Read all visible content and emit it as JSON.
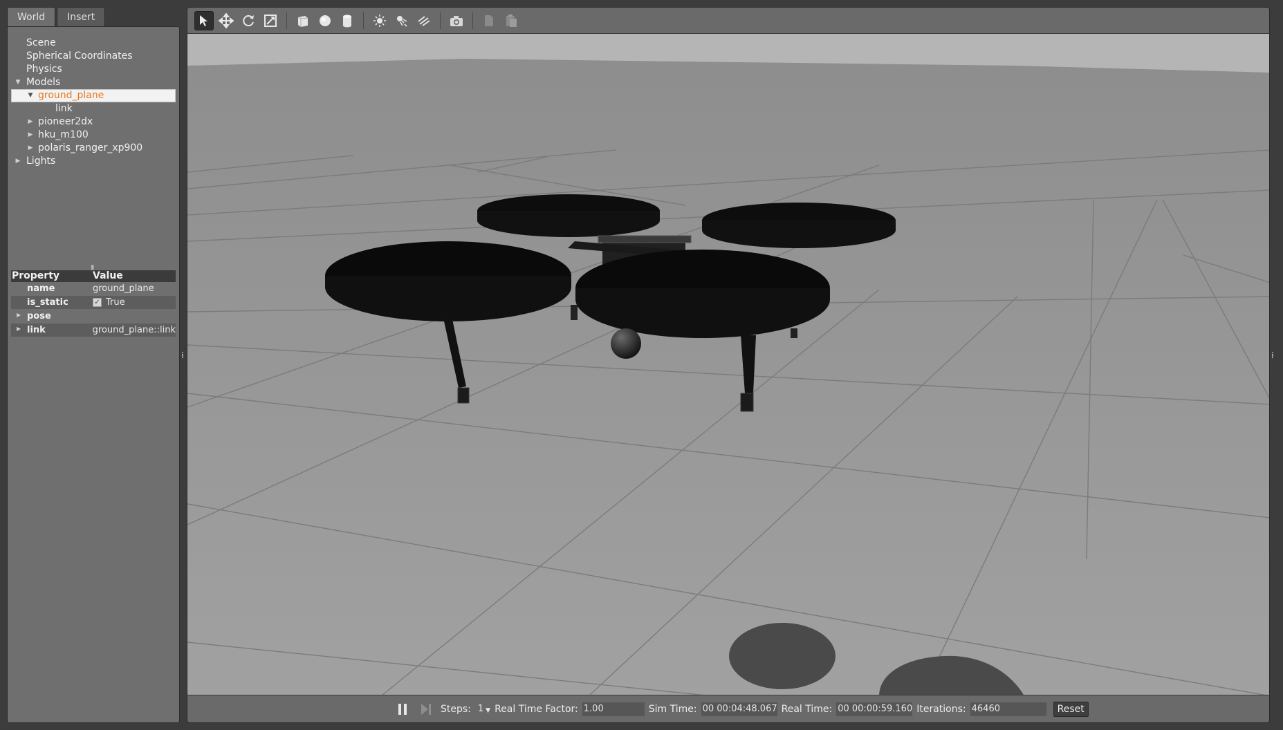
{
  "tabs": [
    {
      "label": "World",
      "active": true
    },
    {
      "label": "Insert",
      "active": false
    }
  ],
  "tree": {
    "scene": "Scene",
    "spherical": "Spherical Coordinates",
    "physics": "Physics",
    "models": "Models",
    "ground_plane": "ground_plane",
    "link": "link",
    "pioneer": "pioneer2dx",
    "hku": "hku_m100",
    "polaris": "polaris_ranger_xp900",
    "lights": "Lights"
  },
  "properties": {
    "header_property": "Property",
    "header_value": "Value",
    "rows": [
      {
        "key": "name",
        "value": "ground_plane"
      },
      {
        "key": "is_static",
        "value": "True"
      },
      {
        "key": "pose",
        "value": ""
      },
      {
        "key": "link",
        "value": "ground_plane::link"
      }
    ]
  },
  "toolbar": {
    "icons": [
      "select-arrow-icon",
      "translate-icon",
      "rotate-icon",
      "scale-icon",
      "box-icon",
      "sphere-icon",
      "cylinder-icon",
      "point-light-icon",
      "spot-light-icon",
      "directional-light-icon",
      "screenshot-icon",
      "copy-icon",
      "paste-icon"
    ]
  },
  "bottombar": {
    "steps_label": "Steps:",
    "steps_value": "1",
    "rtf_label": "Real Time Factor:",
    "rtf_value": "1.00",
    "sim_label": "Sim Time:",
    "sim_value": "00 00:04:48.067",
    "real_label": "Real Time:",
    "real_value": "00 00:00:59.160",
    "iter_label": "Iterations:",
    "iter_value": "46460",
    "reset_label": "Reset"
  },
  "colors": {
    "selection_text": "#e8781e",
    "panel_bg": "#6f6f6f",
    "sky": "#b0b0b0",
    "ground": "#9a9a9a"
  }
}
